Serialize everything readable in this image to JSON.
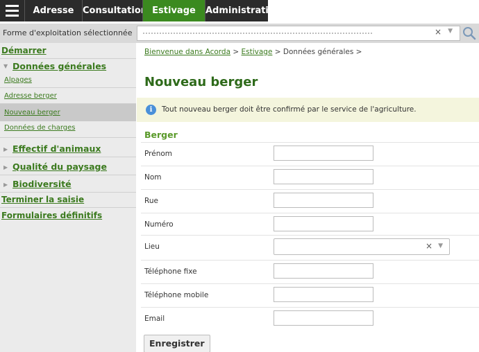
{
  "topnav": {
    "tabs": [
      "Adresse",
      "Consultation",
      "Estivage",
      "Administration"
    ],
    "active_tab": "Estivage",
    "active_color": "#3b8a1f"
  },
  "farm_selector": {
    "label": "Forme d'exploitation sélectionnée"
  },
  "sidebar": {
    "start": "Démarrer",
    "general_data": "Données générales",
    "items": [
      "Alpages",
      "Adresse berger",
      "Nouveau berger",
      "Données de charges"
    ],
    "selected_item": "Nouveau berger",
    "animal_count": "Effectif d'animaux",
    "landscape_quality": "Qualité du paysage",
    "biodiversity": "Biodiversité",
    "finish_entry": "Terminer la saisie",
    "final_forms": "Formulaires définitifs"
  },
  "breadcrumb": {
    "home": "Bienvenue dans Acorda",
    "sep1": " > ",
    "section": "Estivage",
    "sep2": " > ",
    "current": "Données générales >"
  },
  "page": {
    "title": "Nouveau berger",
    "notice": "Tout nouveau berger doit être confirmé par le service de l'agriculture.",
    "section_title": "Berger"
  },
  "form": {
    "fields": [
      "Prénom",
      "Nom",
      "Rue",
      "Numéro",
      "Lieu",
      "Téléphone fixe",
      "Téléphone mobile",
      "Email"
    ]
  },
  "actions": {
    "save": "Enregistrer"
  },
  "colors": {
    "brand_green": "#3b7a1e",
    "title_green": "#2e6a1a",
    "section_green": "#5a9a2a",
    "nav_dark": "#2b2b2b",
    "notice_bg": "#f4f5dd",
    "info_blue": "#4a90d9"
  }
}
